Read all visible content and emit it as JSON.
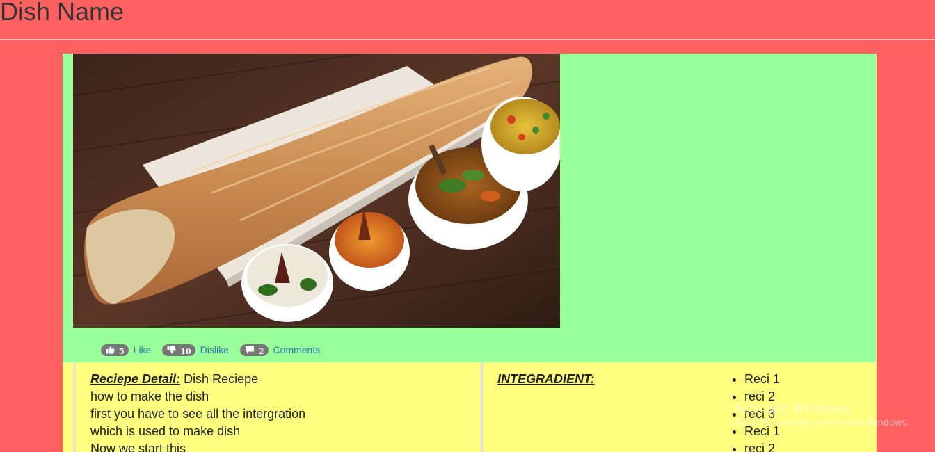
{
  "header": {
    "title": "Dish Name"
  },
  "media": {
    "image_icon": "dish-photo",
    "social": {
      "like": {
        "icon": "thumbs-up-icon",
        "count": "5",
        "label": "Like"
      },
      "dislike": {
        "icon": "thumbs-down-icon",
        "count": "10",
        "label": "Dislike"
      },
      "comments": {
        "icon": "comment-icon",
        "count": "2",
        "label": "Comments"
      }
    }
  },
  "recipe": {
    "heading": "Reciepe Detail:",
    "intro": " Dish Reciepe",
    "lines": [
      "how to make the dish",
      "first you have to see all the intergration",
      "which is used to make dish",
      "Now we start this"
    ]
  },
  "ingredients": {
    "heading": "INTEGRADIENT:",
    "items": [
      "Reci 1",
      "reci 2",
      "reci 3",
      "Reci 1",
      "reci 2"
    ]
  },
  "watermark": {
    "title": "Activate Windows",
    "subtitle": "Go to PC settings to activate Windows."
  },
  "colors": {
    "page_background": "#ff6161",
    "media_panel": "#99ff99",
    "detail_panel": "#ffff80",
    "link": "#337ab7",
    "badge": "#777777"
  }
}
